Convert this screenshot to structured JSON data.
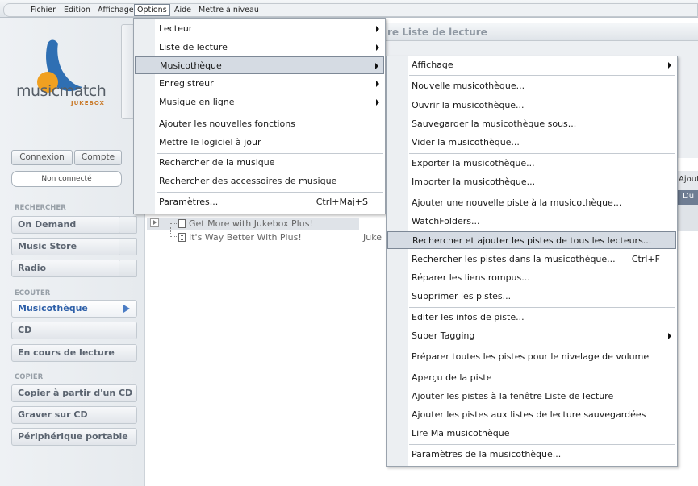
{
  "menubar": {
    "items": [
      "Fichier",
      "Edition",
      "Affichage",
      "Options",
      "Aide",
      "Mettre à niveau"
    ]
  },
  "logo": {
    "name": "musicmatch",
    "sub": "JUKEBOX"
  },
  "account": {
    "connexion": "Connexion",
    "compte": "Compte",
    "status": "Non connecté"
  },
  "sidebar": {
    "section_rechercher": "RECHERCHER",
    "rechercher_items": [
      "On Demand",
      "Music Store",
      "Radio"
    ],
    "section_ecouter": "ECOUTER",
    "ecouter_items": [
      "Musicothèque",
      "CD",
      "En cours de lecture"
    ],
    "section_copier": "COPIER",
    "copier_items": [
      "Copier à partir d'un CD",
      "Graver sur CD",
      "Périphérique portable"
    ]
  },
  "playlist": {
    "title": "re Liste de lecture",
    "col_partial": "Ajout",
    "col_partial2": "Du"
  },
  "tracks": [
    {
      "title": "Get More with Jukebox Plus!",
      "artist": ""
    },
    {
      "title": "It's Way Better With Plus!",
      "artist": "Juke"
    }
  ],
  "options_menu": [
    {
      "label": "Lecteur",
      "sub": true
    },
    {
      "label": "Liste de lecture",
      "sub": true
    },
    {
      "label": "Musicothèque",
      "sub": true
    },
    {
      "label": "Enregistreur",
      "sub": true
    },
    {
      "label": "Musique en ligne",
      "sub": true
    },
    {
      "label": "Ajouter les nouvelles fonctions"
    },
    {
      "label": "Mettre le logiciel à jour"
    },
    {
      "label": "Rechercher de la musique"
    },
    {
      "label": "Rechercher des accessoires de musique"
    },
    {
      "label": "Paramètres...",
      "shortcut": "Ctrl+Maj+S"
    }
  ],
  "library_menu": [
    {
      "label": "Affichage",
      "sub": true
    },
    {
      "label": "Nouvelle musicothèque..."
    },
    {
      "label": "Ouvrir la musicothèque..."
    },
    {
      "label": "Sauvegarder la musicothèque sous..."
    },
    {
      "label": "Vider la musicothèque..."
    },
    {
      "label": "Exporter la musicothèque..."
    },
    {
      "label": "Importer la musicothèque..."
    },
    {
      "label": "Ajouter une nouvelle piste à la musicothèque..."
    },
    {
      "label": "WatchFolders..."
    },
    {
      "label": "Rechercher et ajouter les pistes de tous les lecteurs..."
    },
    {
      "label": "Rechercher les pistes dans la musicothèque...",
      "shortcut": "Ctrl+F"
    },
    {
      "label": "Réparer les liens rompus..."
    },
    {
      "label": "Supprimer les pistes..."
    },
    {
      "label": "Editer les infos de piste..."
    },
    {
      "label": "Super Tagging",
      "sub": true
    },
    {
      "label": "Préparer toutes les pistes pour le nivelage de volume"
    },
    {
      "label": "Aperçu de la piste"
    },
    {
      "label": "Ajouter les pistes à la fenêtre Liste de lecture"
    },
    {
      "label": "Ajouter les pistes aux listes de lecture sauvegardées"
    },
    {
      "label": "Lire Ma musicothèque"
    },
    {
      "label": "Paramètres de la musicothèque..."
    }
  ],
  "colors": {
    "accent": "#4a7cc4",
    "logo_blue": "#2f6fb3",
    "logo_orange": "#f0a020"
  }
}
